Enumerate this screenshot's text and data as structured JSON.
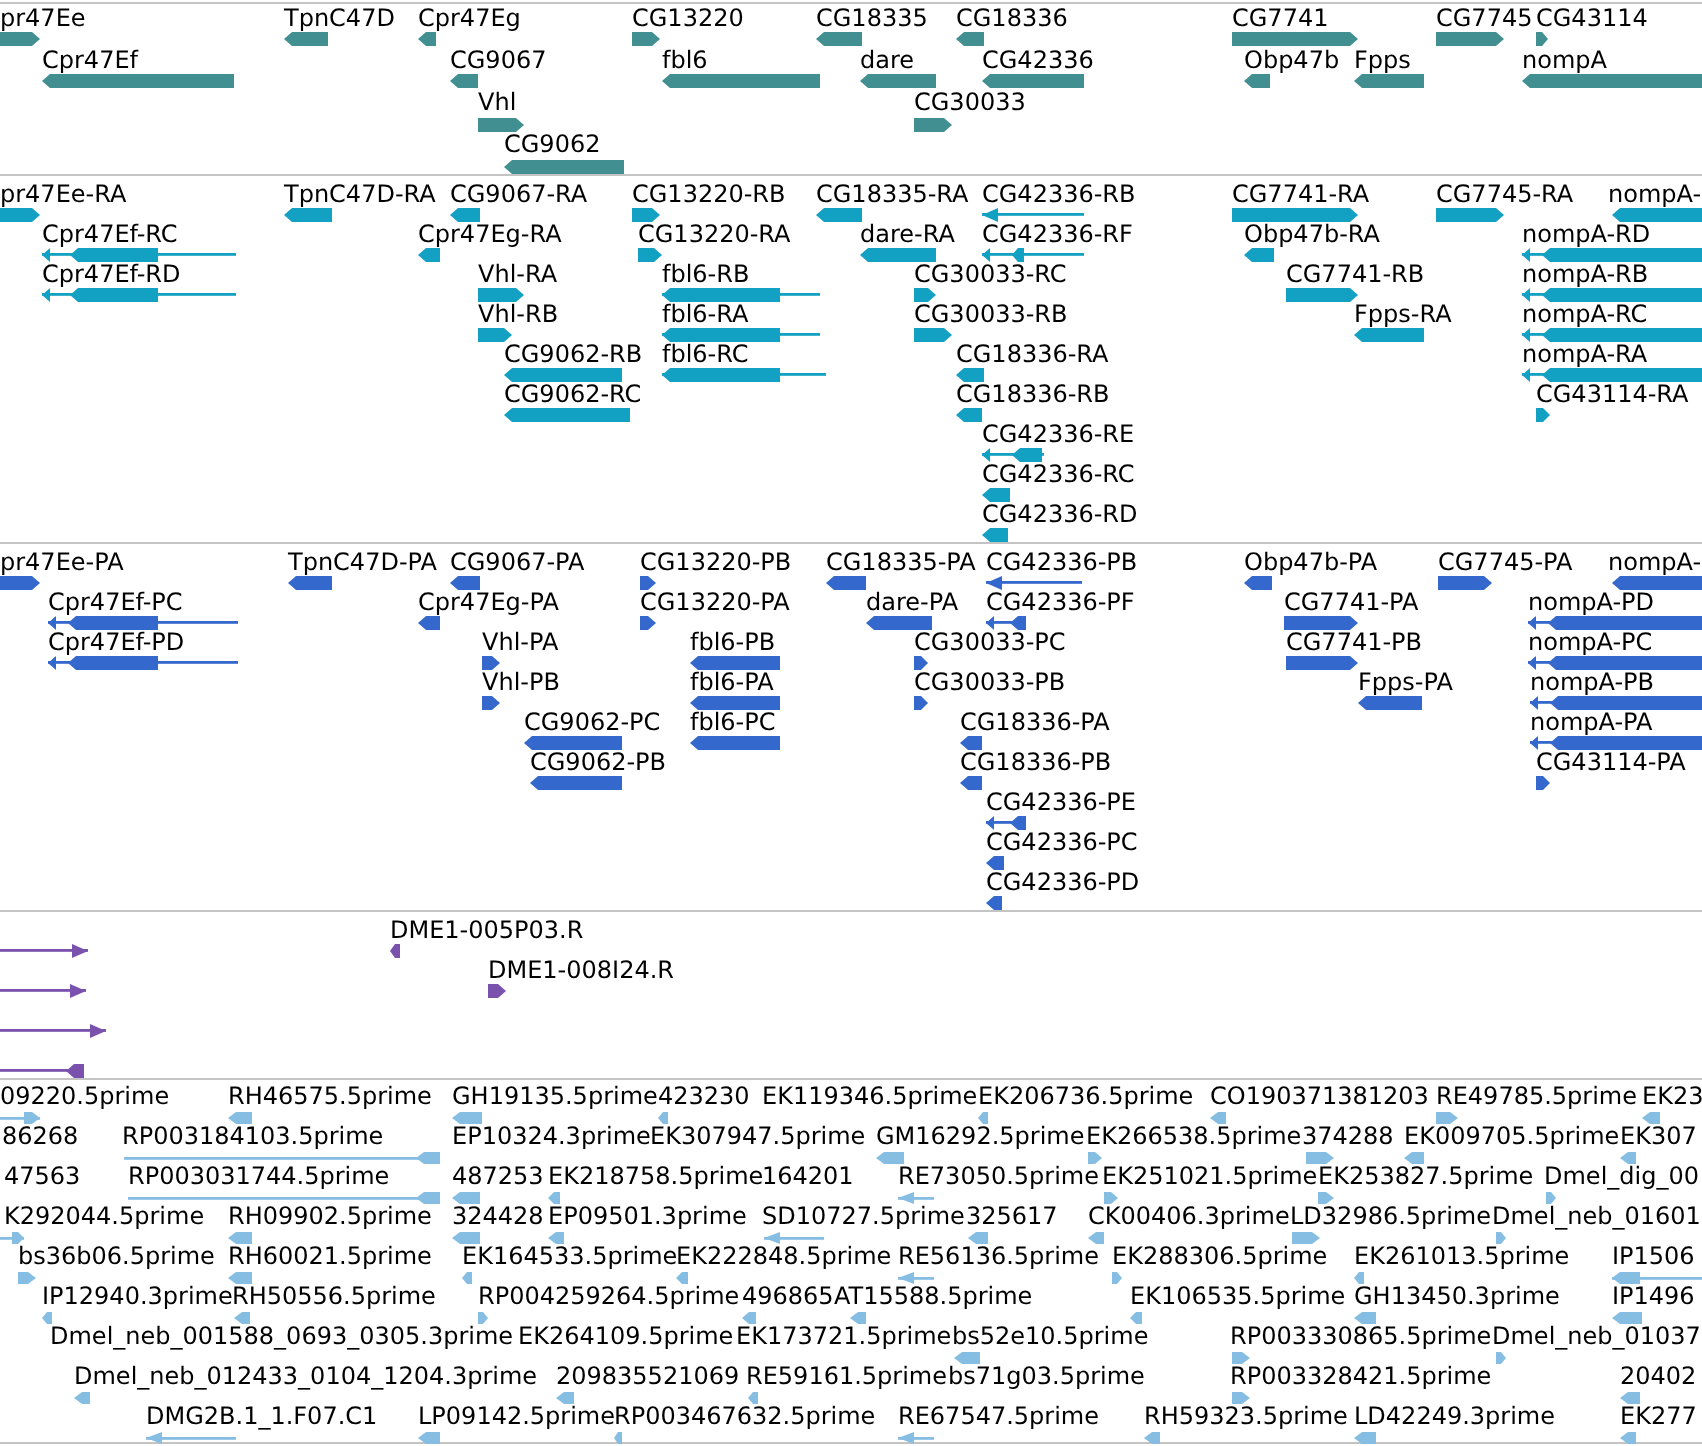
{
  "tracks": [
    {
      "kind": "gene",
      "rows": [
        {
          "features": [
            {
              "label": "pr47Ee",
              "reverse": false
            },
            {
              "label": "TpnC47D",
              "reverse": true
            },
            {
              "label": "Cpr47Eg",
              "reverse": true
            },
            {
              "label": "CG13220",
              "reverse": false
            },
            {
              "label": "CG18335",
              "reverse": true
            },
            {
              "label": "CG18336",
              "reverse": true
            },
            {
              "label": "CG7741",
              "reverse": false
            },
            {
              "label": "CG7745",
              "reverse": false
            },
            {
              "label": "CG43114",
              "reverse": false
            }
          ]
        },
        {
          "features": [
            {
              "label": "Cpr47Ef",
              "reverse": true
            },
            {
              "label": "CG9067",
              "reverse": true
            },
            {
              "label": "fbl6",
              "reverse": true
            },
            {
              "label": "dare",
              "reverse": true
            },
            {
              "label": "CG42336",
              "reverse": true
            },
            {
              "label": "Obp47b",
              "reverse": true
            },
            {
              "label": "Fpps",
              "reverse": true
            },
            {
              "label": "nompA",
              "reverse": true
            }
          ]
        },
        {
          "features": [
            {
              "label": "Vhl",
              "reverse": false
            },
            {
              "label": "CG30033",
              "reverse": false
            }
          ]
        },
        {
          "features": [
            {
              "label": "CG9062",
              "reverse": true
            }
          ]
        }
      ]
    },
    {
      "kind": "transcript",
      "rows": [
        {
          "features": [
            {
              "label": "pr47Ee-RA",
              "reverse": false
            },
            {
              "label": "TpnC47D-RA",
              "reverse": true
            },
            {
              "label": "CG9067-RA",
              "reverse": true
            },
            {
              "label": "CG13220-RB",
              "reverse": false
            },
            {
              "label": "CG18335-RA",
              "reverse": true
            },
            {
              "label": "CG42336-RB",
              "reverse": true
            },
            {
              "label": "CG7741-RA",
              "reverse": false
            },
            {
              "label": "CG7745-RA",
              "reverse": false
            },
            {
              "label": "nompA-",
              "reverse": true
            }
          ]
        },
        {
          "features": [
            {
              "label": "Cpr47Ef-RC",
              "reverse": true
            },
            {
              "label": "Cpr47Eg-RA",
              "reverse": true
            },
            {
              "label": "CG13220-RA",
              "reverse": false
            },
            {
              "label": "dare-RA",
              "reverse": true
            },
            {
              "label": "CG42336-RF",
              "reverse": true
            },
            {
              "label": "Obp47b-RA",
              "reverse": true
            },
            {
              "label": "nompA-RD",
              "reverse": true
            }
          ]
        },
        {
          "features": [
            {
              "label": "Cpr47Ef-RD",
              "reverse": true
            },
            {
              "label": "Vhl-RA",
              "reverse": false
            },
            {
              "label": "fbl6-RB",
              "reverse": true
            },
            {
              "label": "CG30033-RC",
              "reverse": false
            },
            {
              "label": "CG7741-RB",
              "reverse": false
            },
            {
              "label": "nompA-RB",
              "reverse": true
            }
          ]
        },
        {
          "features": [
            {
              "label": "Vhl-RB",
              "reverse": false
            },
            {
              "label": "fbl6-RA",
              "reverse": true
            },
            {
              "label": "CG30033-RB",
              "reverse": false
            },
            {
              "label": "Fpps-RA",
              "reverse": true
            },
            {
              "label": "nompA-RC",
              "reverse": true
            }
          ]
        },
        {
          "features": [
            {
              "label": "CG9062-RB",
              "reverse": true
            },
            {
              "label": "fbl6-RC",
              "reverse": true
            },
            {
              "label": "CG18336-RA",
              "reverse": true
            },
            {
              "label": "nompA-RA",
              "reverse": true
            }
          ]
        },
        {
          "features": [
            {
              "label": "CG9062-RC",
              "reverse": true
            },
            {
              "label": "CG18336-RB",
              "reverse": true
            },
            {
              "label": "CG43114-RA",
              "reverse": false
            }
          ]
        },
        {
          "features": [
            {
              "label": "CG42336-RE",
              "reverse": true
            }
          ]
        },
        {
          "features": [
            {
              "label": "CG42336-RC",
              "reverse": true
            }
          ]
        },
        {
          "features": [
            {
              "label": "CG42336-RD",
              "reverse": true
            }
          ]
        }
      ]
    },
    {
      "kind": "protein",
      "rows": [
        {
          "features": [
            {
              "label": "pr47Ee-PA",
              "reverse": false
            },
            {
              "label": "TpnC47D-PA",
              "reverse": true
            },
            {
              "label": "CG9067-PA",
              "reverse": true
            },
            {
              "label": "CG13220-PB",
              "reverse": false
            },
            {
              "label": "CG18335-PA",
              "reverse": true
            },
            {
              "label": "CG42336-PB",
              "reverse": true
            },
            {
              "label": "Obp47b-PA",
              "reverse": true
            },
            {
              "label": "CG7745-PA",
              "reverse": false
            },
            {
              "label": "nompA-",
              "reverse": true
            }
          ]
        },
        {
          "features": [
            {
              "label": "Cpr47Ef-PC",
              "reverse": true
            },
            {
              "label": "Cpr47Eg-PA",
              "reverse": true
            },
            {
              "label": "CG13220-PA",
              "reverse": false
            },
            {
              "label": "dare-PA",
              "reverse": true
            },
            {
              "label": "CG42336-PF",
              "reverse": true
            },
            {
              "label": "CG7741-PA",
              "reverse": false
            },
            {
              "label": "nompA-PD",
              "reverse": true
            }
          ]
        },
        {
          "features": [
            {
              "label": "Cpr47Ef-PD",
              "reverse": true
            },
            {
              "label": "Vhl-PA",
              "reverse": false
            },
            {
              "label": "fbl6-PB",
              "reverse": true
            },
            {
              "label": "CG30033-PC",
              "reverse": false
            },
            {
              "label": "CG7741-PB",
              "reverse": false
            },
            {
              "label": "nompA-PC",
              "reverse": true
            }
          ]
        },
        {
          "features": [
            {
              "label": "Vhl-PB",
              "reverse": false
            },
            {
              "label": "fbl6-PA",
              "reverse": true
            },
            {
              "label": "CG30033-PB",
              "reverse": false
            },
            {
              "label": "Fpps-PA",
              "reverse": true
            },
            {
              "label": "nompA-PB",
              "reverse": true
            }
          ]
        },
        {
          "features": [
            {
              "label": "CG9062-PC",
              "reverse": true
            },
            {
              "label": "fbl6-PC",
              "reverse": true
            },
            {
              "label": "CG18336-PA",
              "reverse": true
            },
            {
              "label": "nompA-PA",
              "reverse": true
            }
          ]
        },
        {
          "features": [
            {
              "label": "CG9062-PB",
              "reverse": true
            },
            {
              "label": "CG18336-PB",
              "reverse": true
            },
            {
              "label": "CG43114-PA",
              "reverse": false
            }
          ]
        },
        {
          "features": [
            {
              "label": "CG42336-PE",
              "reverse": true
            }
          ]
        },
        {
          "features": [
            {
              "label": "CG42336-PC",
              "reverse": true
            }
          ]
        },
        {
          "features": [
            {
              "label": "CG42336-PD",
              "reverse": true
            }
          ]
        }
      ]
    },
    {
      "kind": "clone",
      "rows": [
        {
          "features": [
            {
              "reverse": false
            },
            {
              "label": "DME1-005P03.R",
              "reverse": true
            }
          ]
        },
        {
          "features": [
            {
              "reverse": false
            },
            {
              "label": "DME1-008I24.R",
              "reverse": false
            }
          ]
        },
        {
          "features": [
            {
              "reverse": false
            }
          ]
        },
        {
          "features": [
            {
              "reverse": true
            }
          ]
        }
      ]
    },
    {
      "kind": "est",
      "rows": [
        {
          "features": [
            {
              "label": "09220.5prime",
              "reverse": false
            },
            {
              "label": "RH46575.5prime",
              "reverse": true
            },
            {
              "label": "GH19135.5prime",
              "reverse": true
            },
            {
              "label": "423230",
              "reverse": true
            },
            {
              "label": "EK119346.5prime"
            },
            {
              "label": "EK206736.5prime",
              "reverse": true
            },
            {
              "label": "CO190371381203",
              "reverse": true
            },
            {
              "label": "RE49785.5prime",
              "reverse": false
            },
            {
              "label": "EK23",
              "reverse": true
            }
          ]
        },
        {
          "features": [
            {
              "label": "86268"
            },
            {
              "label": "RP003184103.5prime",
              "reverse": true
            },
            {
              "label": "EP10324.3prime"
            },
            {
              "label": "EK307947.5prime"
            },
            {
              "label": "GM16292.5prime",
              "reverse": true
            },
            {
              "label": "EK266538.5prime",
              "reverse": false
            },
            {
              "label": "374288",
              "reverse": false
            },
            {
              "label": "EK009705.5prime",
              "reverse": true
            },
            {
              "label": "EK307",
              "reverse": true
            }
          ]
        },
        {
          "features": [
            {
              "label": "47563"
            },
            {
              "label": "RP003031744.5prime",
              "reverse": true
            },
            {
              "label": "487253",
              "reverse": true
            },
            {
              "label": "EK218758.5prime",
              "reverse": true
            },
            {
              "label": "164201"
            },
            {
              "label": "RE73050.5prime",
              "reverse": true
            },
            {
              "label": "EK251021.5prime",
              "reverse": false
            },
            {
              "label": "EK253827.5prime",
              "reverse": false
            },
            {
              "label": "Dmel_dig_00",
              "reverse": false
            }
          ]
        },
        {
          "features": [
            {
              "label": "K292044.5prime",
              "reverse": false
            },
            {
              "label": "RH09902.5prime",
              "reverse": true
            },
            {
              "label": "324428",
              "reverse": true
            },
            {
              "label": "EP09501.3prime",
              "reverse": true
            },
            {
              "label": "SD10727.5prime",
              "reverse": true
            },
            {
              "label": "325617",
              "reverse": true
            },
            {
              "label": "CK00406.3prime",
              "reverse": true
            },
            {
              "label": "LD32986.5prime",
              "reverse": false
            },
            {
              "label": "Dmel_neb_01601",
              "reverse": false
            }
          ]
        },
        {
          "features": [
            {
              "label": "bs36b06.5prime",
              "reverse": false
            },
            {
              "label": "RH60021.5prime",
              "reverse": true
            },
            {
              "label": "EK164533.5prime",
              "reverse": true
            },
            {
              "label": "EK222848.5prime",
              "reverse": true
            },
            {
              "label": "RE56136.5prime",
              "reverse": true
            },
            {
              "label": "EK288306.5prime",
              "reverse": false
            },
            {
              "label": "EK261013.5prime",
              "reverse": true
            },
            {
              "label": "IP1506",
              "reverse": true
            }
          ]
        },
        {
          "features": [
            {
              "label": "IP12940.3prime",
              "reverse": true
            },
            {
              "label": "RH50556.5prime",
              "reverse": true
            },
            {
              "label": "RP004259264.5prime",
              "reverse": false
            },
            {
              "label": "496865",
              "reverse": true
            },
            {
              "label": "AT15588.5prime",
              "reverse": true
            },
            {
              "label": "EK106535.5prime",
              "reverse": true
            },
            {
              "label": "GH13450.3prime",
              "reverse": true
            },
            {
              "label": "IP1496",
              "reverse": true
            }
          ]
        },
        {
          "features": [
            {
              "label": "Dmel_neb_001588_0693_0305.3prime"
            },
            {
              "label": "EK264109.5prime"
            },
            {
              "label": "EK173721.5prime"
            },
            {
              "label": "bs52e10.5prime",
              "reverse": true
            },
            {
              "label": "RP003330865.5prime",
              "reverse": false
            },
            {
              "label": "Dmel_neb_01037",
              "reverse": false
            }
          ]
        },
        {
          "features": [
            {
              "label": "Dmel_neb_012433_0104_1204.3prime",
              "reverse": true
            },
            {
              "label": "209835521069",
              "reverse": true
            },
            {
              "label": "RE59161.5prime",
              "reverse": true
            },
            {
              "label": "bs71g03.5prime"
            },
            {
              "label": "RP003328421.5prime",
              "reverse": false
            },
            {
              "label": "20402",
              "reverse": true
            }
          ]
        },
        {
          "features": [
            {
              "label": "DMG2B.1_1.F07.C1",
              "reverse": true
            },
            {
              "label": "LP09142.5prime",
              "reverse": true
            },
            {
              "label": "RP003467632.5prime",
              "reverse": true
            },
            {
              "label": "RE67547.5prime",
              "reverse": true
            },
            {
              "label": "RH59323.5prime",
              "reverse": true
            },
            {
              "label": "LD42249.3prime",
              "reverse": true
            },
            {
              "label": "EK277",
              "reverse": true
            }
          ]
        }
      ]
    }
  ]
}
